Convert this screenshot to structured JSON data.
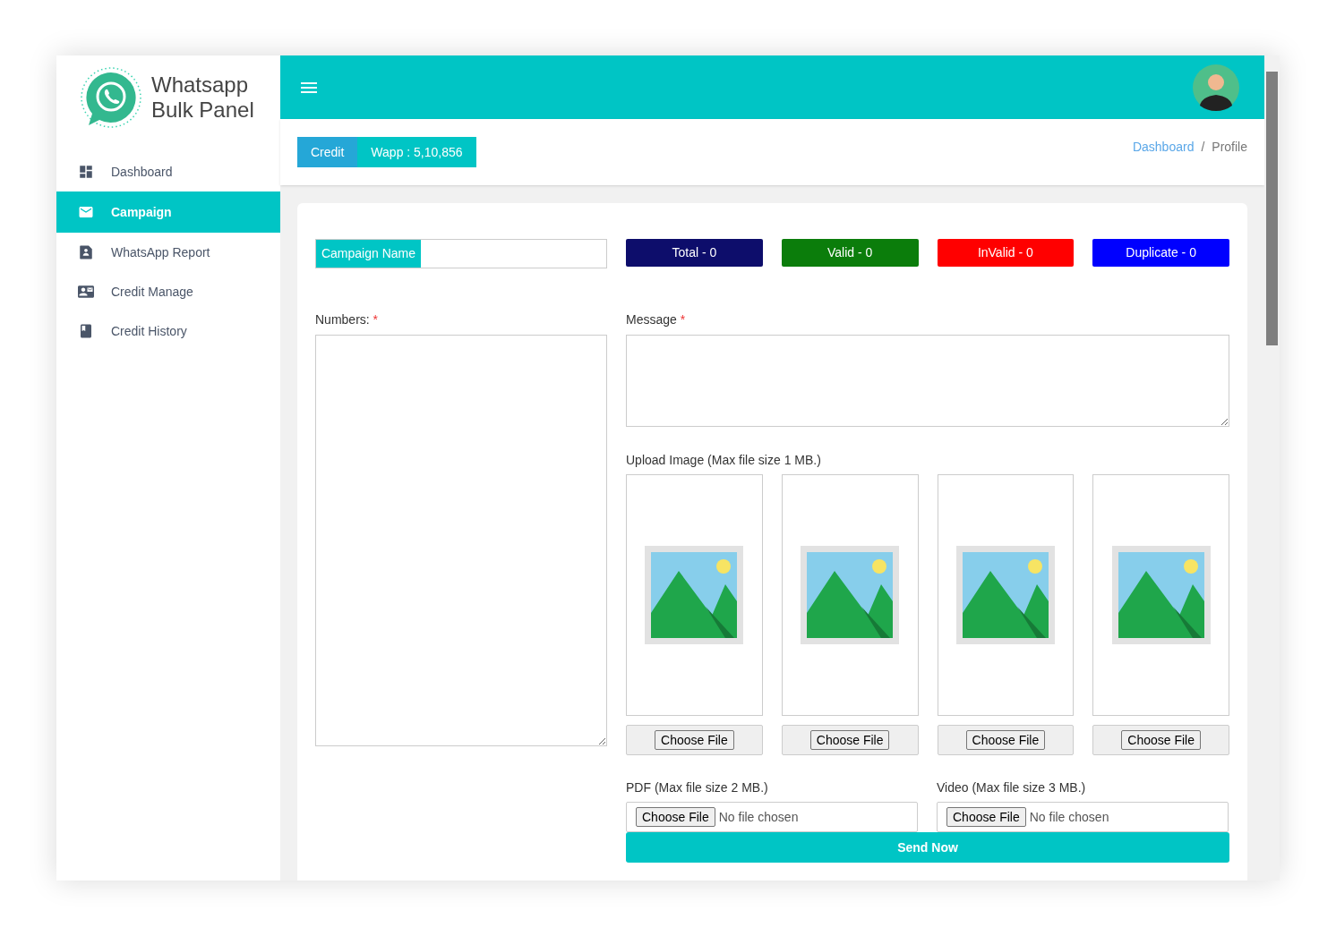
{
  "brand": {
    "line1": "Whatsapp",
    "line2": "Bulk Panel"
  },
  "sidebar": {
    "items": [
      {
        "label": "Dashboard",
        "selected": false
      },
      {
        "label": "Campaign",
        "selected": true
      },
      {
        "label": "WhatsApp Report",
        "selected": false
      },
      {
        "label": "Credit Manage",
        "selected": false
      },
      {
        "label": "Credit History",
        "selected": false
      }
    ]
  },
  "credit": {
    "label": "Credit",
    "value": "Wapp : 5,10,856"
  },
  "breadcrumb": {
    "link": "Dashboard",
    "separator": "/",
    "current": "Profile"
  },
  "campaign_name": {
    "label": "Campaign Name"
  },
  "stats": [
    {
      "label": "Total - 0",
      "color": "#0d0d6b"
    },
    {
      "label": "Valid - 0",
      "color": "#0b7d0b"
    },
    {
      "label": "InValid - 0",
      "color": "#ff0000"
    },
    {
      "label": "Duplicate - 0",
      "color": "#0000ff"
    }
  ],
  "numbers": {
    "label": "Numbers:",
    "required": "*"
  },
  "message": {
    "label": "Message",
    "required": "*"
  },
  "upload_image": {
    "label": "Upload Image (Max file size 1 MB.)",
    "slots": [
      {
        "button": "Choose File"
      },
      {
        "button": "Choose File"
      },
      {
        "button": "Choose File"
      },
      {
        "button": "Choose File"
      }
    ]
  },
  "pdf": {
    "label": "PDF (Max file size 2 MB.)",
    "button": "Choose File",
    "status": "No file chosen"
  },
  "video": {
    "label": "Video (Max file size 3 MB.)",
    "button": "Choose File",
    "status": "No file chosen"
  },
  "send_button": "Send Now"
}
